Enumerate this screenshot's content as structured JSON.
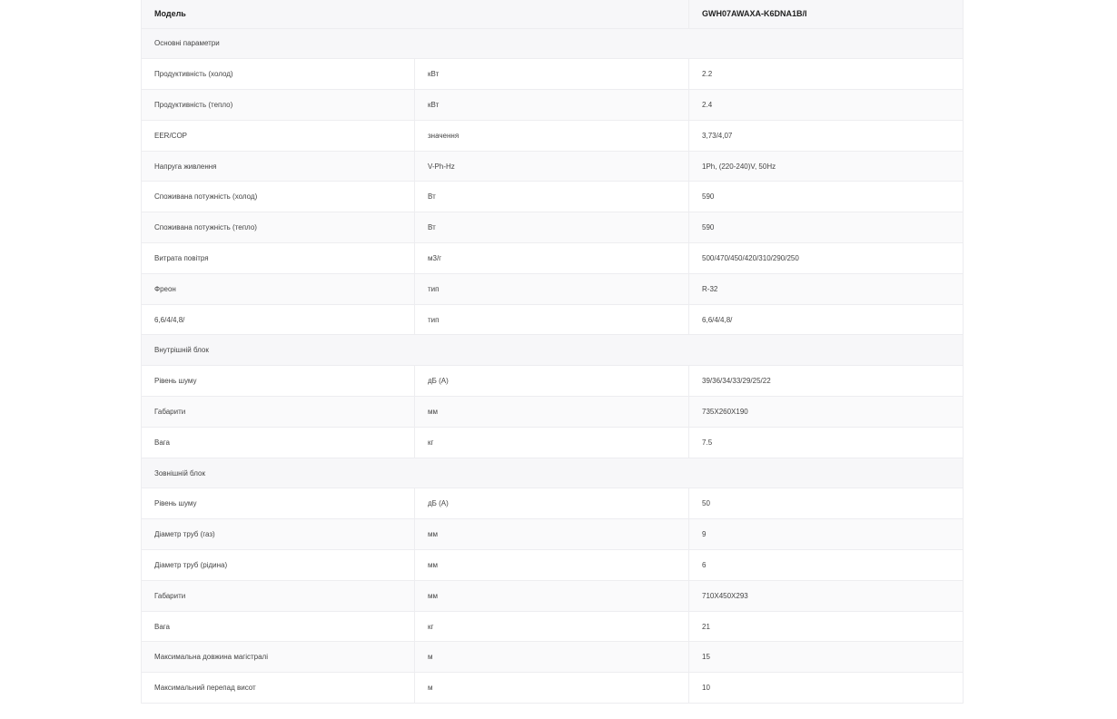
{
  "header": {
    "model_label": "Модель",
    "model_value": "GWH07AWAXA-K6DNA1B/I"
  },
  "sections": [
    {
      "title": "Основні параметри",
      "rows": [
        {
          "name": "Продуктивність (холод)",
          "unit": "кВт",
          "value": "2.2"
        },
        {
          "name": "Продуктивність (тепло)",
          "unit": "кВт",
          "value": "2.4"
        },
        {
          "name": "EER/COP",
          "unit": "значення",
          "value": "3,73/4,07"
        },
        {
          "name": "Напруга живлення",
          "unit": "V-Ph-Hz",
          "value": "1Ph, (220-240)V, 50Hz"
        },
        {
          "name": "Споживана потужність (холод)",
          "unit": "Вт",
          "value": "590"
        },
        {
          "name": "Споживана потужність (тепло)",
          "unit": "Вт",
          "value": "590"
        },
        {
          "name": "Витрата повітря",
          "unit": "м3/г",
          "value": "500/470/450/420/310/290/250"
        },
        {
          "name": "Фреон",
          "unit": "тип",
          "value": "R-32"
        },
        {
          "name": "6,6/4/4,8/",
          "unit": "тип",
          "value": "6,6/4/4,8/"
        }
      ]
    },
    {
      "title": "Внутрішній блок",
      "rows": [
        {
          "name": "Рівень шуму",
          "unit": "дБ (А)",
          "value": "39/36/34/33/29/25/22"
        },
        {
          "name": "Габарити",
          "unit": "мм",
          "value": "735X260X190"
        },
        {
          "name": "Вага",
          "unit": "кг",
          "value": "7.5"
        }
      ]
    },
    {
      "title": "Зовнішній блок",
      "rows": [
        {
          "name": "Рівень шуму",
          "unit": "дБ (А)",
          "value": "50"
        },
        {
          "name": "Діаметр труб (газ)",
          "unit": "мм",
          "value": "9"
        },
        {
          "name": "Діаметр труб (рідина)",
          "unit": "мм",
          "value": "6"
        },
        {
          "name": "Габарити",
          "unit": "мм",
          "value": "710X450X293"
        },
        {
          "name": "Вага",
          "unit": "кг",
          "value": "21"
        },
        {
          "name": "Максимальна довжина магістралі",
          "unit": "м",
          "value": "15"
        },
        {
          "name": "Максимальний перепад висот",
          "unit": "м",
          "value": "10"
        }
      ]
    }
  ]
}
